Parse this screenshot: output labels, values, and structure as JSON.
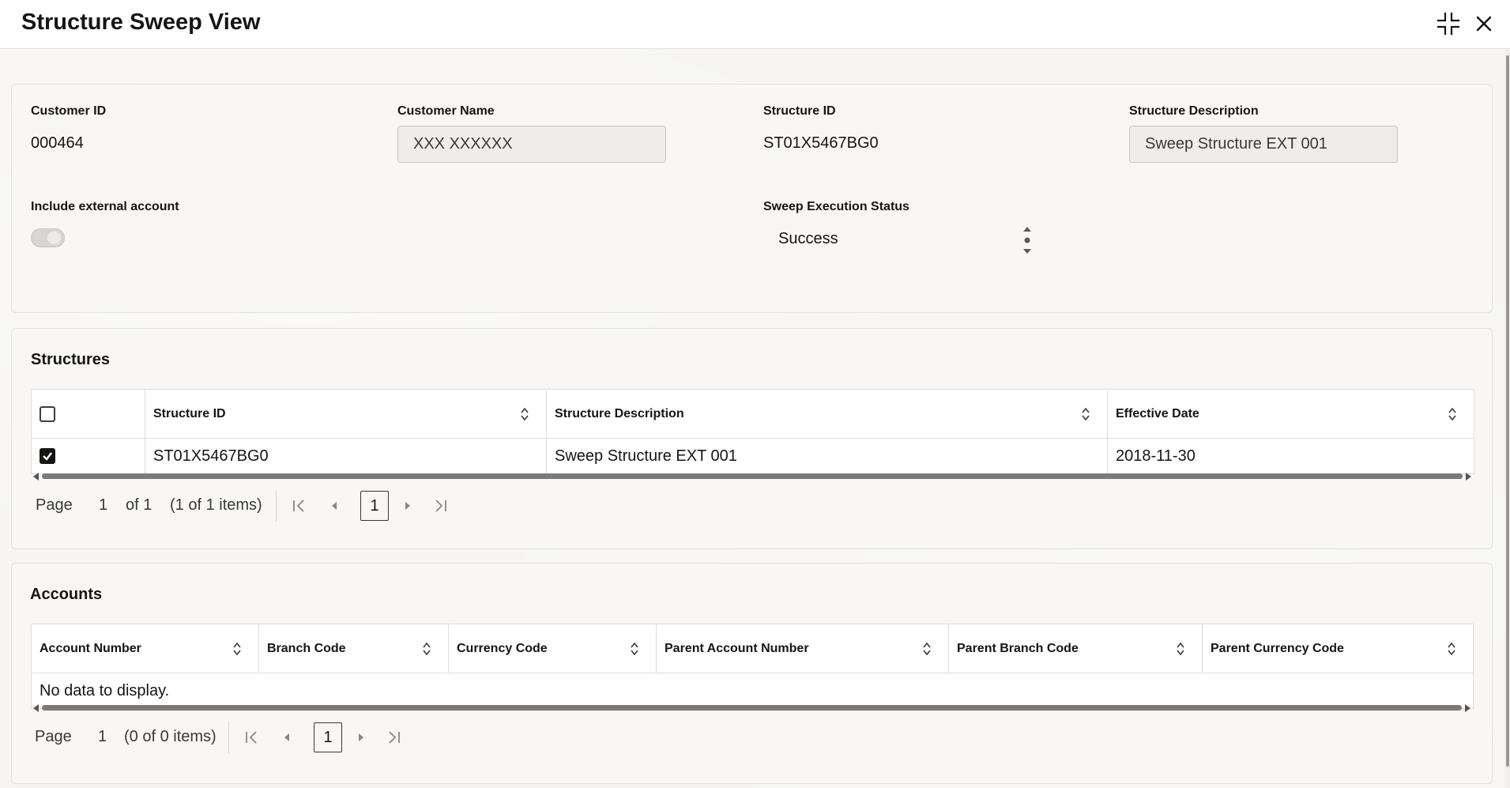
{
  "header": {
    "title": "Structure Sweep View"
  },
  "details": {
    "customer_id_label": "Customer ID",
    "customer_id_value": "000464",
    "customer_name_label": "Customer Name",
    "customer_name_value": "XXX XXXXXX",
    "structure_id_label": "Structure ID",
    "structure_id_value": "ST01X5467BG0",
    "structure_desc_label": "Structure Description",
    "structure_desc_value": "Sweep Structure EXT 001",
    "include_external_label": "Include external account",
    "include_external_on": false,
    "sweep_status_label": "Sweep Execution Status",
    "sweep_status_value": "Success"
  },
  "structures": {
    "title": "Structures",
    "columns": [
      "Structure ID",
      "Structure Description",
      "Effective Date"
    ],
    "rows": [
      {
        "selected": true,
        "cells": [
          "ST01X5467BG0",
          "Sweep Structure EXT 001",
          "2018-11-30"
        ]
      }
    ],
    "pager": {
      "page_label": "Page",
      "page_value": "1",
      "of_text": "of 1",
      "items_text": "(1 of 1 items)",
      "current": "1"
    }
  },
  "accounts": {
    "title": "Accounts",
    "columns": [
      "Account Number",
      "Branch Code",
      "Currency Code",
      "Parent Account Number",
      "Parent Branch Code",
      "Parent Currency Code"
    ],
    "empty_text": "No data to display.",
    "pager": {
      "page_label": "Page",
      "page_value": "1",
      "items_text": "(0 of 0 items)",
      "current": "1"
    }
  },
  "icons": {
    "collapse": "collapse-icon",
    "close": "close-icon",
    "sort": "sort-icon",
    "first_page": "first-page-icon",
    "prev_page": "previous-page-icon",
    "next_page": "next-page-icon",
    "last_page": "last-page-icon"
  },
  "colors": {
    "text": "#161513",
    "background": "#f6f5f3",
    "panel": "#f8f7f6",
    "checkbox_checked": "#161513"
  }
}
